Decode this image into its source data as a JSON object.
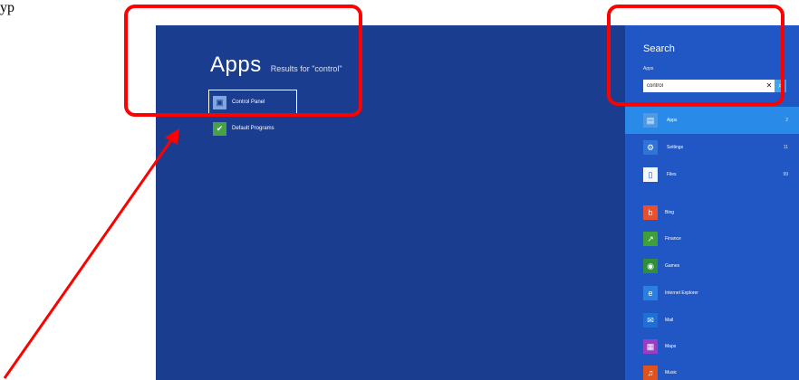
{
  "top_text": "yp",
  "apps": {
    "title": "Apps",
    "subtitle": "Results for \"control\"",
    "results": [
      {
        "label": "Control Panel",
        "icon": "control-panel-icon",
        "selected": true
      },
      {
        "label": "Default Programs",
        "icon": "default-programs-icon",
        "selected": false
      }
    ]
  },
  "search": {
    "title": "Search",
    "label": "Apps",
    "query": "control",
    "clear_symbol": "✕",
    "go_symbol": "⌕"
  },
  "scopes": [
    {
      "label": "Apps",
      "count": "2",
      "icon": "apps-icon",
      "active": true
    },
    {
      "label": "Settings",
      "count": "11",
      "icon": "settings-icon",
      "active": false
    },
    {
      "label": "Files",
      "count": "99",
      "icon": "files-icon",
      "active": false
    }
  ],
  "app_items": [
    {
      "label": "Bing",
      "icon": "bing-icon",
      "color": "#e8502f"
    },
    {
      "label": "Finance",
      "icon": "finance-icon",
      "color": "#3f9f3a"
    },
    {
      "label": "Games",
      "icon": "games-icon",
      "color": "#2f8f3a"
    },
    {
      "label": "Internet Explorer",
      "icon": "internet-explorer-icon",
      "color": "#2a7fe0"
    },
    {
      "label": "Mail",
      "icon": "mail-icon",
      "color": "#1f6fd6"
    },
    {
      "label": "Maps",
      "icon": "maps-icon",
      "color": "#9a3cc4"
    },
    {
      "label": "Music",
      "icon": "music-icon",
      "color": "#e0531f"
    }
  ],
  "colors": {
    "screen_bg": "#1a3d8f",
    "charm_bg": "#2057c4",
    "highlight": "#ff0000"
  }
}
